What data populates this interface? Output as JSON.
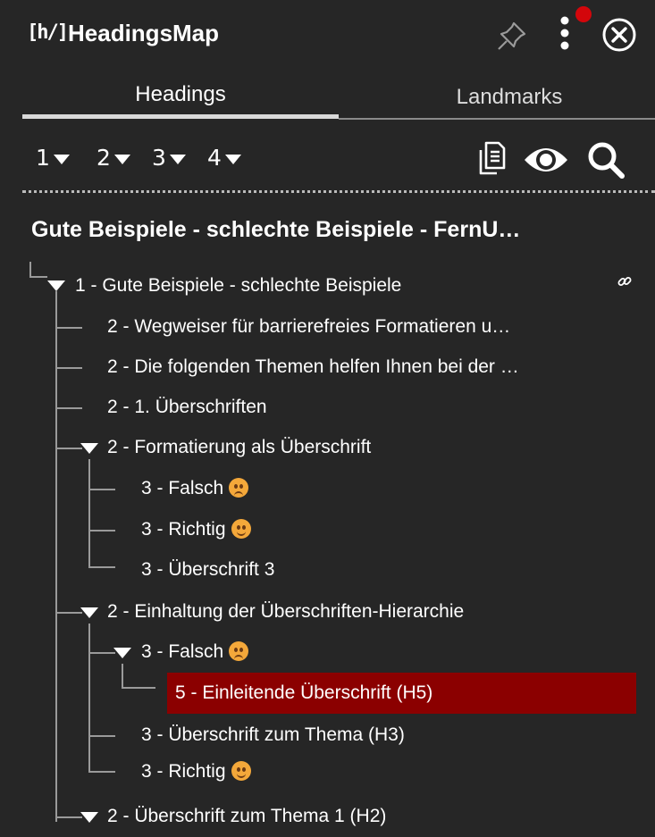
{
  "header": {
    "logo_text": "[h/]",
    "app_title": "HeadingsMap",
    "icons": [
      "pin-icon",
      "more-vertical-icon",
      "close-circle-icon"
    ],
    "notification_color": "#d3060b"
  },
  "tabs": [
    {
      "label": "Headings",
      "active": true
    },
    {
      "label": "Landmarks",
      "active": false
    }
  ],
  "toolbar": {
    "levels": [
      "1",
      "2",
      "3",
      "4"
    ],
    "tools": [
      "copy-icon",
      "eye-icon",
      "search-icon"
    ]
  },
  "page_title": "Gute Beispiele - schlechte Beispiele - FernU…",
  "tree": [
    {
      "text": "1 - Gute Beispiele - schlechte Beispiele",
      "level": 1
    },
    {
      "text": "2 - Wegweiser für barrierefreies Formatieren u…",
      "level": 2
    },
    {
      "text": "2 - Die folgenden Themen helfen Ihnen bei der …",
      "level": 2
    },
    {
      "text": "2 - 1. Überschriften",
      "level": 2
    },
    {
      "text": "2 - Formatierung als Überschrift",
      "level": 2
    },
    {
      "text": "3 - Falsch",
      "level": 3,
      "emoji": "sad-face-icon"
    },
    {
      "text": "3 - Richtig",
      "level": 3,
      "emoji": "smiling-face-icon"
    },
    {
      "text": "3 - Überschrift 3",
      "level": 3
    },
    {
      "text": "2 - Einhaltung der Überschriften-Hierarchie",
      "level": 2
    },
    {
      "text": "3 - Falsch",
      "level": 3,
      "emoji": "sad-face-icon"
    },
    {
      "text": "5 - Einleitende Überschrift (H5)",
      "level": 5,
      "selected": true
    },
    {
      "text": "3 - Überschrift zum Thema (H3)",
      "level": 3
    },
    {
      "text": "3 - Richtig",
      "level": 3,
      "emoji": "smiling-face-icon"
    },
    {
      "text": "2 - Überschrift zum Thema 1 (H2)",
      "level": 2
    }
  ],
  "colors": {
    "background": "#262626",
    "selected_background": "#8b0000",
    "emoji": "#f4a83a"
  }
}
